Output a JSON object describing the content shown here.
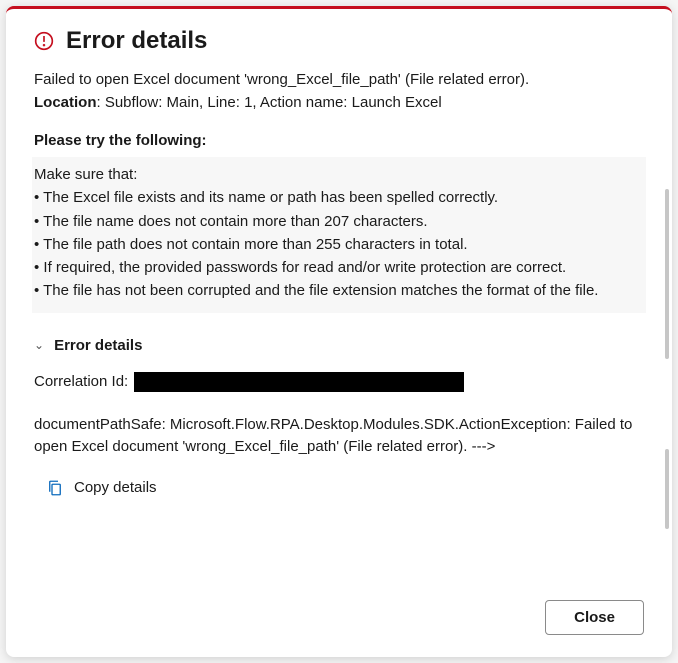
{
  "header": {
    "title": "Error details"
  },
  "summary": {
    "message": "Failed to open Excel document 'wrong_Excel_file_path' (File related error).",
    "location_label": "Location",
    "location_value": ": Subflow: Main, Line: 1, Action name: Launch Excel"
  },
  "suggestions": {
    "title": "Please try the following:",
    "intro": "Make sure that:",
    "items": [
      "• The Excel file exists and its name or path has been spelled correctly.",
      "• The file name does not contain more than 207 characters.",
      "• The file path does not contain more than 255 characters in total.",
      "• If required, the provided passwords for read and/or write protection are correct.",
      "• The file has not been corrupted and the file extension matches the format of the file."
    ]
  },
  "details": {
    "toggle_label": "Error details",
    "correlation_label": "Correlation Id:",
    "stack_text": "documentPathSafe: Microsoft.Flow.RPA.Desktop.Modules.SDK.ActionException: Failed to open Excel document 'wrong_Excel_file_path' (File related error). --->"
  },
  "actions": {
    "copy_label": "Copy details",
    "close_label": "Close"
  }
}
